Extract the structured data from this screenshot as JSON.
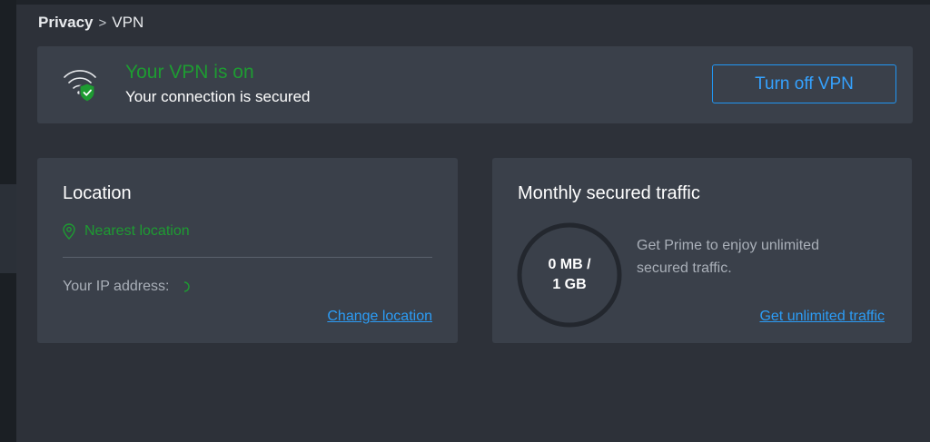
{
  "breadcrumb": {
    "root": "Privacy",
    "separator": ">",
    "current": "VPN"
  },
  "status": {
    "title": "Your VPN is on",
    "subtitle": "Your connection is secured",
    "button_label": "Turn off VPN",
    "icon": "wifi-shield-icon",
    "title_color": "#1e9b32",
    "accent": "#2196f3"
  },
  "location": {
    "title": "Location",
    "current": "Nearest location",
    "ip_label": "Your IP address:",
    "change_link": "Change location",
    "pin_icon": "location-pin-icon"
  },
  "traffic": {
    "title": "Monthly secured traffic",
    "used": "0 MB /",
    "limit": "1 GB",
    "promo": "Get Prime to enjoy unlimited secured traffic.",
    "link": "Get unlimited traffic",
    "used_fraction": 0
  }
}
